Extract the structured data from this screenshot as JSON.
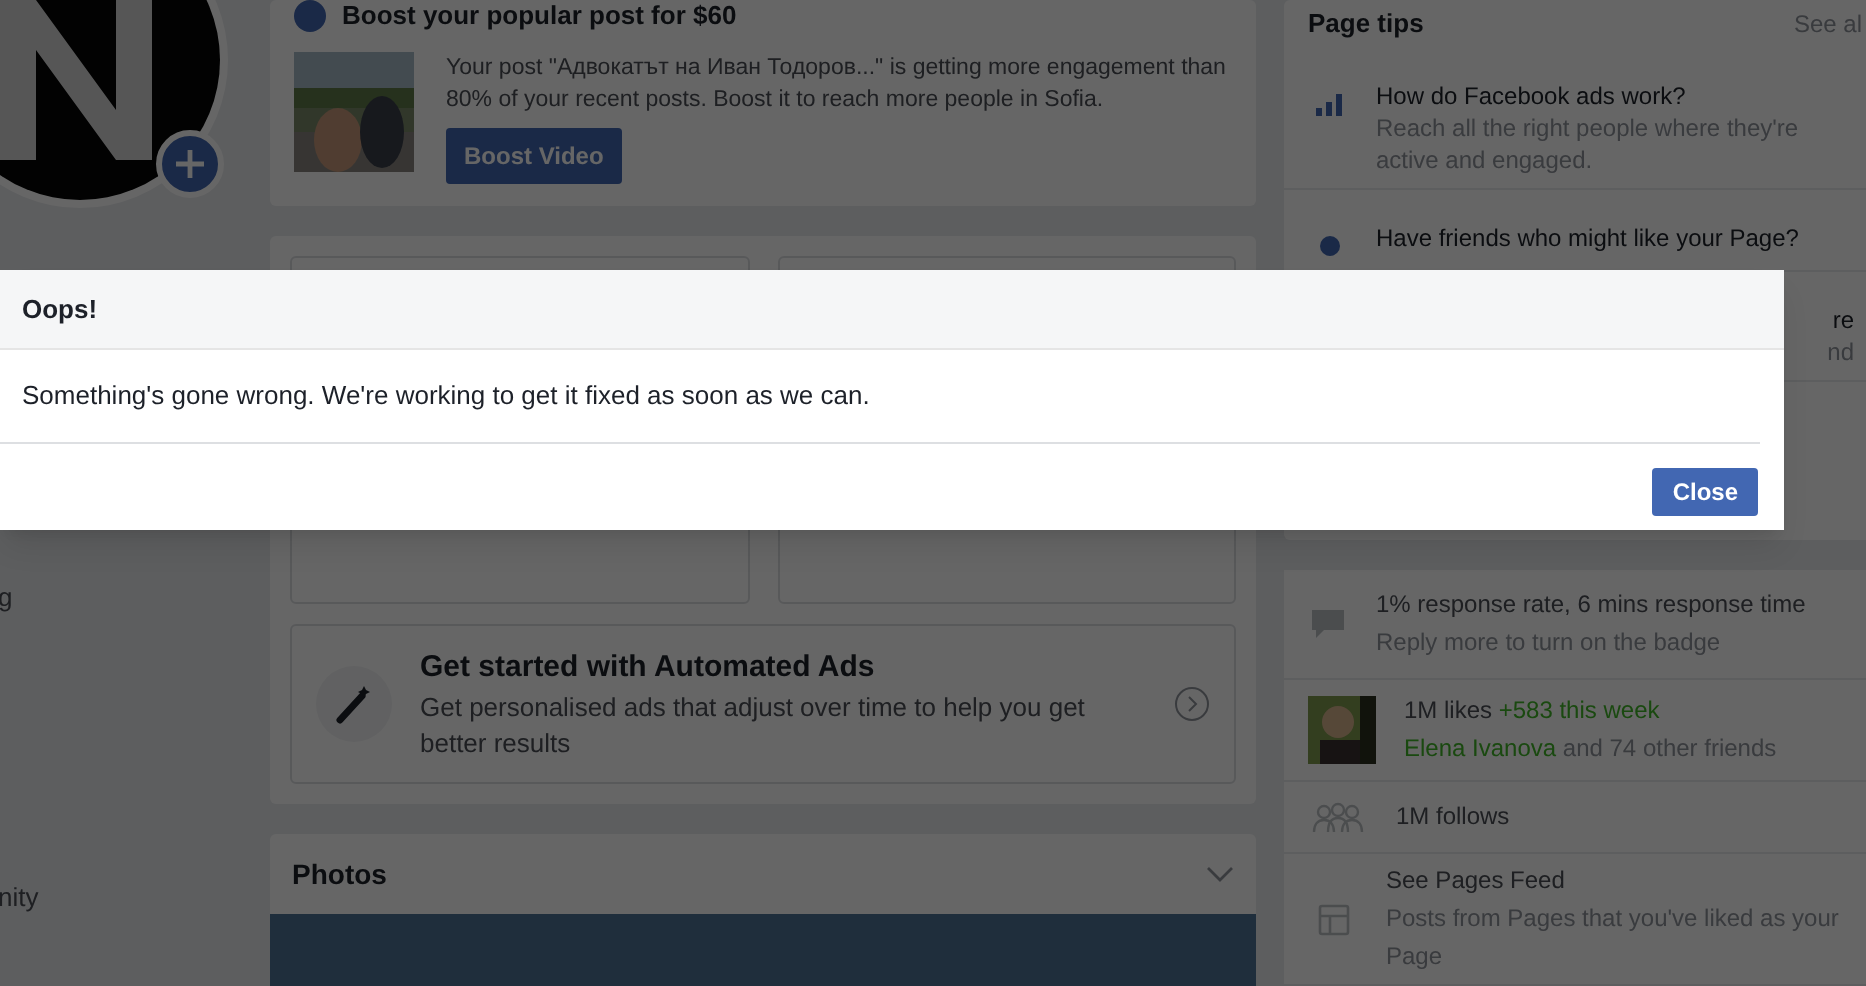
{
  "sidebar": {
    "items": [
      {
        "label": "g"
      },
      {
        "label": "nity"
      }
    ]
  },
  "boost_card": {
    "title": "Boost your popular post for $60",
    "text": "Your post \"Адвокатът на Иван Тодоров...\" is getting more engagement than 80% of your recent posts. Boost it to reach more people in Sofia.",
    "button": "Boost Video"
  },
  "automated_ads": {
    "title": "Get started with Automated Ads",
    "text": "Get personalised ads that adjust over time to help you get better results"
  },
  "photos": {
    "title": "Photos"
  },
  "page_tips": {
    "title": "Page tips",
    "link": "See al",
    "items": [
      {
        "kind": "chart",
        "title": "How do Facebook ads work?",
        "text": "Reach all the right people where they're active and engaged."
      },
      {
        "kind": "pin",
        "title": "Have friends who might like your Page?"
      },
      {
        "kind": "fragment",
        "title": "re",
        "text": "nd"
      }
    ]
  },
  "stats": [
    {
      "kind": "response",
      "title": "1% response rate, 6 mins response time",
      "text": "Reply more to turn on the badge"
    },
    {
      "kind": "likes",
      "title": "1M likes",
      "highlight": "+583 this week",
      "friend": "Elena Ivanova",
      "text": "and 74 other friends"
    },
    {
      "kind": "follows",
      "title": "1M follows"
    },
    {
      "kind": "feed",
      "title": "See Pages Feed",
      "text": "Posts from Pages that you've liked as your Page"
    }
  ],
  "dialog": {
    "title": "Oops!",
    "message": "Something's gone wrong. We're working to get it fixed as soon as we can.",
    "button": "Close"
  }
}
